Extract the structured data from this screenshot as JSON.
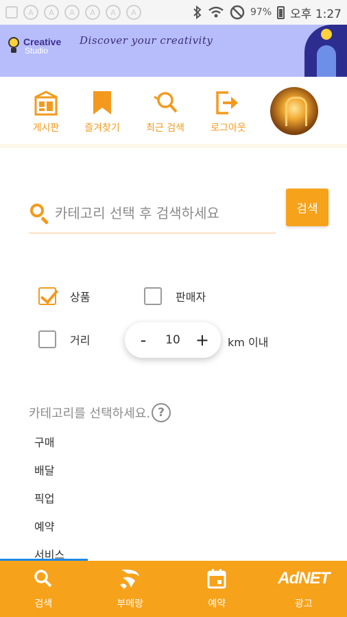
{
  "status_bar": {
    "battery": "97%",
    "time": "오후 1:27",
    "icons": [
      "notification-icon",
      "notification-icon",
      "notification-icon",
      "notification-icon",
      "notification-icon",
      "notification-icon",
      "notification-icon",
      "bluetooth-icon",
      "wifi-icon",
      "do-not-disturb-icon",
      "battery-icon"
    ]
  },
  "banner": {
    "logo_line1": "Creative",
    "logo_line2": "Studio",
    "tagline": "Discover your creativity"
  },
  "top_nav": {
    "items": [
      {
        "label": "게시판",
        "icon": "board-icon"
      },
      {
        "label": "즐겨찾기",
        "icon": "bookmark-icon"
      },
      {
        "label": "최근 검색",
        "icon": "recent-search-icon"
      },
      {
        "label": "로그아웃",
        "icon": "logout-icon"
      }
    ],
    "accent": "#f39a1e"
  },
  "search": {
    "placeholder": "카테고리 선택 후 검색하세요",
    "button_label": "검색"
  },
  "filters": {
    "product": {
      "label": "상품",
      "checked": true
    },
    "seller": {
      "label": "판매자",
      "checked": false
    },
    "distance": {
      "label": "거리",
      "checked": false
    },
    "stepper": {
      "minus": "-",
      "value": "10",
      "plus": "+"
    },
    "unit_label": "km 이내"
  },
  "category": {
    "title": "카테고리를 선택하세요.",
    "help_glyph": "?",
    "items": [
      "구매",
      "배달",
      "픽업",
      "예약",
      "서비스"
    ]
  },
  "bottom_nav": {
    "items": [
      {
        "label": "검색",
        "icon": "search-icon"
      },
      {
        "label": "부메랑",
        "icon": "boomerang-icon"
      },
      {
        "label": "예약",
        "icon": "calendar-icon"
      },
      {
        "label": "광고",
        "icon": "adnet-logo",
        "logo_text": "AdNET"
      }
    ],
    "background": "#f7a21b"
  }
}
